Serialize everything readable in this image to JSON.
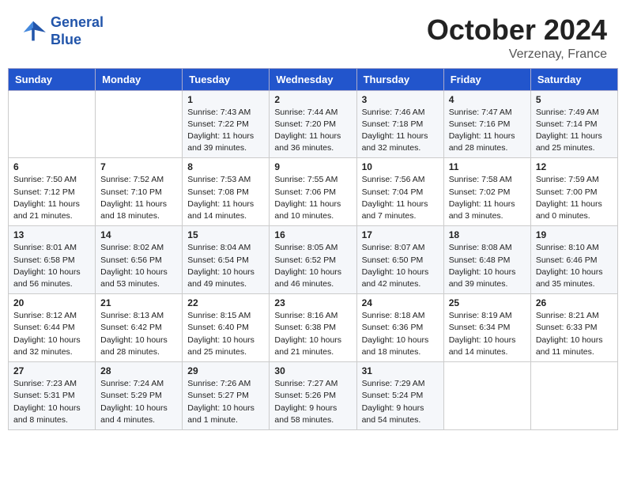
{
  "header": {
    "logo": {
      "line1": "General",
      "line2": "Blue"
    },
    "title": "October 2024",
    "subtitle": "Verzenay, France"
  },
  "days_of_week": [
    "Sunday",
    "Monday",
    "Tuesday",
    "Wednesday",
    "Thursday",
    "Friday",
    "Saturday"
  ],
  "weeks": [
    [
      {
        "day": "",
        "sunrise": "",
        "sunset": "",
        "daylight": ""
      },
      {
        "day": "",
        "sunrise": "",
        "sunset": "",
        "daylight": ""
      },
      {
        "day": "1",
        "sunrise": "Sunrise: 7:43 AM",
        "sunset": "Sunset: 7:22 PM",
        "daylight": "Daylight: 11 hours and 39 minutes."
      },
      {
        "day": "2",
        "sunrise": "Sunrise: 7:44 AM",
        "sunset": "Sunset: 7:20 PM",
        "daylight": "Daylight: 11 hours and 36 minutes."
      },
      {
        "day": "3",
        "sunrise": "Sunrise: 7:46 AM",
        "sunset": "Sunset: 7:18 PM",
        "daylight": "Daylight: 11 hours and 32 minutes."
      },
      {
        "day": "4",
        "sunrise": "Sunrise: 7:47 AM",
        "sunset": "Sunset: 7:16 PM",
        "daylight": "Daylight: 11 hours and 28 minutes."
      },
      {
        "day": "5",
        "sunrise": "Sunrise: 7:49 AM",
        "sunset": "Sunset: 7:14 PM",
        "daylight": "Daylight: 11 hours and 25 minutes."
      }
    ],
    [
      {
        "day": "6",
        "sunrise": "Sunrise: 7:50 AM",
        "sunset": "Sunset: 7:12 PM",
        "daylight": "Daylight: 11 hours and 21 minutes."
      },
      {
        "day": "7",
        "sunrise": "Sunrise: 7:52 AM",
        "sunset": "Sunset: 7:10 PM",
        "daylight": "Daylight: 11 hours and 18 minutes."
      },
      {
        "day": "8",
        "sunrise": "Sunrise: 7:53 AM",
        "sunset": "Sunset: 7:08 PM",
        "daylight": "Daylight: 11 hours and 14 minutes."
      },
      {
        "day": "9",
        "sunrise": "Sunrise: 7:55 AM",
        "sunset": "Sunset: 7:06 PM",
        "daylight": "Daylight: 11 hours and 10 minutes."
      },
      {
        "day": "10",
        "sunrise": "Sunrise: 7:56 AM",
        "sunset": "Sunset: 7:04 PM",
        "daylight": "Daylight: 11 hours and 7 minutes."
      },
      {
        "day": "11",
        "sunrise": "Sunrise: 7:58 AM",
        "sunset": "Sunset: 7:02 PM",
        "daylight": "Daylight: 11 hours and 3 minutes."
      },
      {
        "day": "12",
        "sunrise": "Sunrise: 7:59 AM",
        "sunset": "Sunset: 7:00 PM",
        "daylight": "Daylight: 11 hours and 0 minutes."
      }
    ],
    [
      {
        "day": "13",
        "sunrise": "Sunrise: 8:01 AM",
        "sunset": "Sunset: 6:58 PM",
        "daylight": "Daylight: 10 hours and 56 minutes."
      },
      {
        "day": "14",
        "sunrise": "Sunrise: 8:02 AM",
        "sunset": "Sunset: 6:56 PM",
        "daylight": "Daylight: 10 hours and 53 minutes."
      },
      {
        "day": "15",
        "sunrise": "Sunrise: 8:04 AM",
        "sunset": "Sunset: 6:54 PM",
        "daylight": "Daylight: 10 hours and 49 minutes."
      },
      {
        "day": "16",
        "sunrise": "Sunrise: 8:05 AM",
        "sunset": "Sunset: 6:52 PM",
        "daylight": "Daylight: 10 hours and 46 minutes."
      },
      {
        "day": "17",
        "sunrise": "Sunrise: 8:07 AM",
        "sunset": "Sunset: 6:50 PM",
        "daylight": "Daylight: 10 hours and 42 minutes."
      },
      {
        "day": "18",
        "sunrise": "Sunrise: 8:08 AM",
        "sunset": "Sunset: 6:48 PM",
        "daylight": "Daylight: 10 hours and 39 minutes."
      },
      {
        "day": "19",
        "sunrise": "Sunrise: 8:10 AM",
        "sunset": "Sunset: 6:46 PM",
        "daylight": "Daylight: 10 hours and 35 minutes."
      }
    ],
    [
      {
        "day": "20",
        "sunrise": "Sunrise: 8:12 AM",
        "sunset": "Sunset: 6:44 PM",
        "daylight": "Daylight: 10 hours and 32 minutes."
      },
      {
        "day": "21",
        "sunrise": "Sunrise: 8:13 AM",
        "sunset": "Sunset: 6:42 PM",
        "daylight": "Daylight: 10 hours and 28 minutes."
      },
      {
        "day": "22",
        "sunrise": "Sunrise: 8:15 AM",
        "sunset": "Sunset: 6:40 PM",
        "daylight": "Daylight: 10 hours and 25 minutes."
      },
      {
        "day": "23",
        "sunrise": "Sunrise: 8:16 AM",
        "sunset": "Sunset: 6:38 PM",
        "daylight": "Daylight: 10 hours and 21 minutes."
      },
      {
        "day": "24",
        "sunrise": "Sunrise: 8:18 AM",
        "sunset": "Sunset: 6:36 PM",
        "daylight": "Daylight: 10 hours and 18 minutes."
      },
      {
        "day": "25",
        "sunrise": "Sunrise: 8:19 AM",
        "sunset": "Sunset: 6:34 PM",
        "daylight": "Daylight: 10 hours and 14 minutes."
      },
      {
        "day": "26",
        "sunrise": "Sunrise: 8:21 AM",
        "sunset": "Sunset: 6:33 PM",
        "daylight": "Daylight: 10 hours and 11 minutes."
      }
    ],
    [
      {
        "day": "27",
        "sunrise": "Sunrise: 7:23 AM",
        "sunset": "Sunset: 5:31 PM",
        "daylight": "Daylight: 10 hours and 8 minutes."
      },
      {
        "day": "28",
        "sunrise": "Sunrise: 7:24 AM",
        "sunset": "Sunset: 5:29 PM",
        "daylight": "Daylight: 10 hours and 4 minutes."
      },
      {
        "day": "29",
        "sunrise": "Sunrise: 7:26 AM",
        "sunset": "Sunset: 5:27 PM",
        "daylight": "Daylight: 10 hours and 1 minute."
      },
      {
        "day": "30",
        "sunrise": "Sunrise: 7:27 AM",
        "sunset": "Sunset: 5:26 PM",
        "daylight": "Daylight: 9 hours and 58 minutes."
      },
      {
        "day": "31",
        "sunrise": "Sunrise: 7:29 AM",
        "sunset": "Sunset: 5:24 PM",
        "daylight": "Daylight: 9 hours and 54 minutes."
      },
      {
        "day": "",
        "sunrise": "",
        "sunset": "",
        "daylight": ""
      },
      {
        "day": "",
        "sunrise": "",
        "sunset": "",
        "daylight": ""
      }
    ]
  ]
}
